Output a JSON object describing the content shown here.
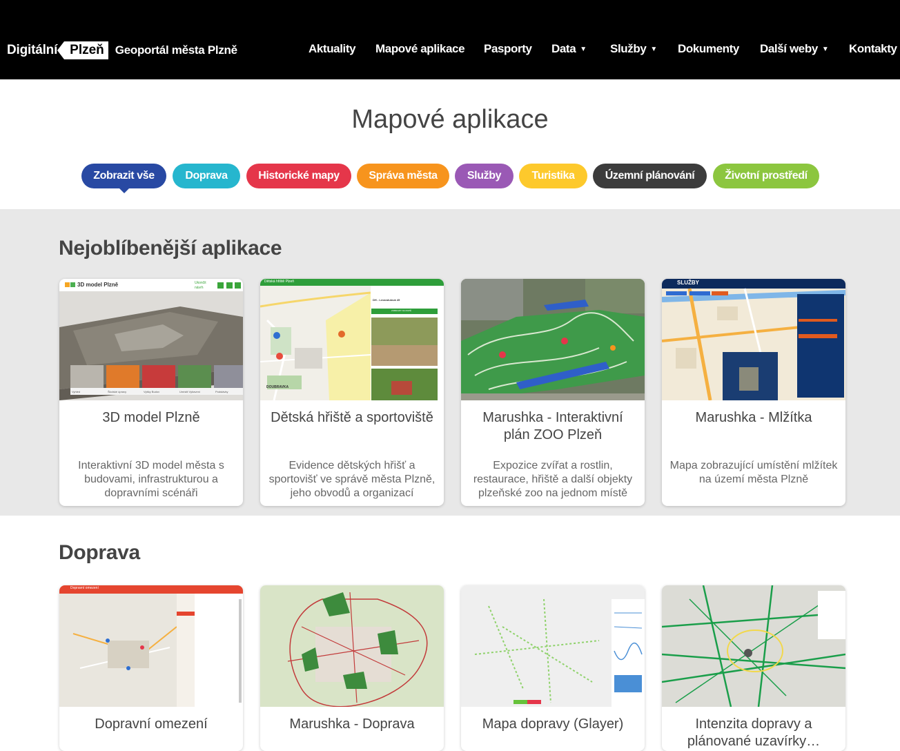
{
  "header": {
    "brand_part1": "Digitální",
    "brand_part2": "Plzeň",
    "brand_site": "Geoportál města Plzně",
    "nav": [
      {
        "label": "Aktuality",
        "dropdown": false
      },
      {
        "label": "Mapové aplikace",
        "dropdown": false
      },
      {
        "label": "Pasporty",
        "dropdown": false
      },
      {
        "label": "Data",
        "dropdown": true
      },
      {
        "label": "Služby",
        "dropdown": true
      },
      {
        "label": "Dokumenty",
        "dropdown": false
      },
      {
        "label": "Další weby",
        "dropdown": true
      },
      {
        "label": "Kontakty",
        "dropdown": false
      }
    ]
  },
  "page_title": "Mapové aplikace",
  "filters": [
    {
      "label": "Zobrazit vše",
      "color": "#2849a3",
      "active": true
    },
    {
      "label": "Doprava",
      "color": "#26b6ce",
      "active": false
    },
    {
      "label": "Historické mapy",
      "color": "#e5364a",
      "active": false
    },
    {
      "label": "Správa města",
      "color": "#f7941d",
      "active": false
    },
    {
      "label": "Služby",
      "color": "#9a59b5",
      "active": false
    },
    {
      "label": "Turistika",
      "color": "#fdc92c",
      "active": false
    },
    {
      "label": "Územní plánování",
      "color": "#3c3c3c",
      "active": false
    },
    {
      "label": "Životní prostředí",
      "color": "#8cc63f",
      "active": false
    }
  ],
  "popular": {
    "title": "Nejoblíbenější aplikace",
    "cards": [
      {
        "title": "3D model Plzně",
        "description": "Interaktivní 3D model města s budovami, infrastrukturou a dopravními scénáři",
        "thumb": "3d-model-thumbnail",
        "thumb_text": {
          "header": "3D model Plzně",
          "link": "Ukončit návrh",
          "tiles": [
            "Vyhled",
            "Školské úpravy",
            "Výšky Budov",
            "Umístit Vybavení",
            "Podstávky"
          ]
        }
      },
      {
        "title": "Dětská hřiště a sportoviště",
        "description": "Evidence dětských hřišť a sportovišť ve správě města Plzně, jeho obvodů a organizací",
        "thumb": "playgrounds-map-thumbnail",
        "thumb_text": {
          "header": "Dětská hřiště Plzeň",
          "item": "DH - Levandulová 45",
          "button": "ZOBRAZIT NA MAPĚ",
          "place": "DOUBRAVKA"
        }
      },
      {
        "title": "Marushka - Interaktivní plán ZOO Plzeň",
        "description": "Expozice zvířat a rostlin, restaurace, hřiště a další objekty plzeňské zoo na jednom místě",
        "thumb": "zoo-aerial-thumbnail"
      },
      {
        "title": "Marushka - Mlžítka",
        "description": "Mapa zobrazující umístění mlžítek na území města Plzně",
        "thumb": "mist-sprayers-map-thumbnail",
        "thumb_text": {
          "header": "SLUŽBY"
        }
      }
    ]
  },
  "doprava": {
    "title": "Doprava",
    "cards": [
      {
        "title": "Dopravní omezení",
        "thumb": "traffic-restrictions-thumbnail",
        "thumb_text": {
          "header": "Dopravní omezení"
        }
      },
      {
        "title": "Marushka - Doprava",
        "thumb": "transport-network-thumbnail"
      },
      {
        "title": "Mapa dopravy (Glayer)",
        "thumb": "traffic-glayer-thumbnail"
      },
      {
        "title": "Intenzita dopravy a plánované uzavírky…",
        "thumb": "traffic-intensity-thumbnail"
      }
    ]
  }
}
